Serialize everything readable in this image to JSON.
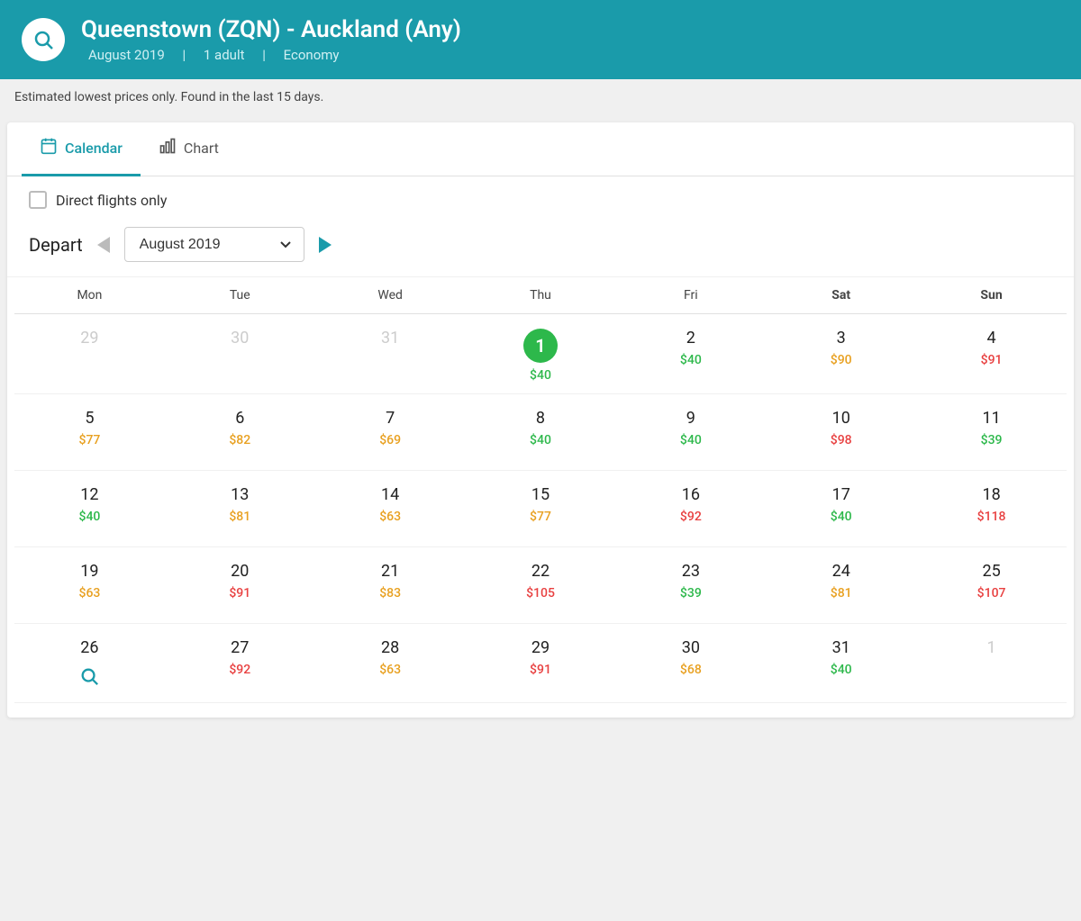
{
  "header": {
    "title": "Queenstown (ZQN) - Auckland (Any)",
    "month": "August 2019",
    "passengers": "1 adult",
    "cabin": "Economy"
  },
  "notice": "Estimated lowest prices only. Found in the last 15 days.",
  "tabs": [
    {
      "id": "calendar",
      "label": "Calendar",
      "icon": "📅",
      "active": true
    },
    {
      "id": "chart",
      "label": "Chart",
      "icon": "📊",
      "active": false
    }
  ],
  "controls": {
    "direct_flights_label": "Direct flights only",
    "depart_label": "Depart",
    "month_value": "August 2019"
  },
  "calendar": {
    "day_names": [
      "Mon",
      "Tue",
      "Wed",
      "Thu",
      "Fri",
      "Sat",
      "Sun"
    ],
    "weeks": [
      [
        {
          "date": "29",
          "inactive": true,
          "price": "",
          "price_class": ""
        },
        {
          "date": "30",
          "inactive": true,
          "price": "",
          "price_class": ""
        },
        {
          "date": "31",
          "inactive": true,
          "price": "",
          "price_class": ""
        },
        {
          "date": "1",
          "inactive": false,
          "today": true,
          "price": "$40",
          "price_class": "price-green"
        },
        {
          "date": "2",
          "inactive": false,
          "price": "$40",
          "price_class": "price-green"
        },
        {
          "date": "3",
          "inactive": false,
          "price": "$90",
          "price_class": "price-orange"
        },
        {
          "date": "4",
          "inactive": false,
          "price": "$91",
          "price_class": "price-red"
        }
      ],
      [
        {
          "date": "5",
          "inactive": false,
          "price": "$77",
          "price_class": "price-orange"
        },
        {
          "date": "6",
          "inactive": false,
          "price": "$82",
          "price_class": "price-orange"
        },
        {
          "date": "7",
          "inactive": false,
          "price": "$69",
          "price_class": "price-orange"
        },
        {
          "date": "8",
          "inactive": false,
          "price": "$40",
          "price_class": "price-green"
        },
        {
          "date": "9",
          "inactive": false,
          "price": "$40",
          "price_class": "price-green"
        },
        {
          "date": "10",
          "inactive": false,
          "price": "$98",
          "price_class": "price-red"
        },
        {
          "date": "11",
          "inactive": false,
          "price": "$39",
          "price_class": "price-green"
        }
      ],
      [
        {
          "date": "12",
          "inactive": false,
          "price": "$40",
          "price_class": "price-green"
        },
        {
          "date": "13",
          "inactive": false,
          "price": "$81",
          "price_class": "price-orange"
        },
        {
          "date": "14",
          "inactive": false,
          "price": "$63",
          "price_class": "price-orange"
        },
        {
          "date": "15",
          "inactive": false,
          "price": "$77",
          "price_class": "price-orange"
        },
        {
          "date": "16",
          "inactive": false,
          "price": "$92",
          "price_class": "price-red"
        },
        {
          "date": "17",
          "inactive": false,
          "price": "$40",
          "price_class": "price-green"
        },
        {
          "date": "18",
          "inactive": false,
          "price": "$118",
          "price_class": "price-red"
        }
      ],
      [
        {
          "date": "19",
          "inactive": false,
          "price": "$63",
          "price_class": "price-orange"
        },
        {
          "date": "20",
          "inactive": false,
          "price": "$91",
          "price_class": "price-red"
        },
        {
          "date": "21",
          "inactive": false,
          "price": "$83",
          "price_class": "price-orange"
        },
        {
          "date": "22",
          "inactive": false,
          "price": "$105",
          "price_class": "price-red"
        },
        {
          "date": "23",
          "inactive": false,
          "price": "$39",
          "price_class": "price-green"
        },
        {
          "date": "24",
          "inactive": false,
          "price": "$81",
          "price_class": "price-orange"
        },
        {
          "date": "25",
          "inactive": false,
          "price": "$107",
          "price_class": "price-red"
        }
      ],
      [
        {
          "date": "26",
          "inactive": false,
          "price": "",
          "price_class": "",
          "search_icon": true
        },
        {
          "date": "27",
          "inactive": false,
          "price": "$92",
          "price_class": "price-red"
        },
        {
          "date": "28",
          "inactive": false,
          "price": "$63",
          "price_class": "price-orange"
        },
        {
          "date": "29",
          "inactive": false,
          "price": "$91",
          "price_class": "price-red"
        },
        {
          "date": "30",
          "inactive": false,
          "price": "$68",
          "price_class": "price-orange"
        },
        {
          "date": "31",
          "inactive": false,
          "price": "$40",
          "price_class": "price-green"
        },
        {
          "date": "1",
          "inactive": true,
          "price": "",
          "price_class": ""
        }
      ]
    ]
  }
}
